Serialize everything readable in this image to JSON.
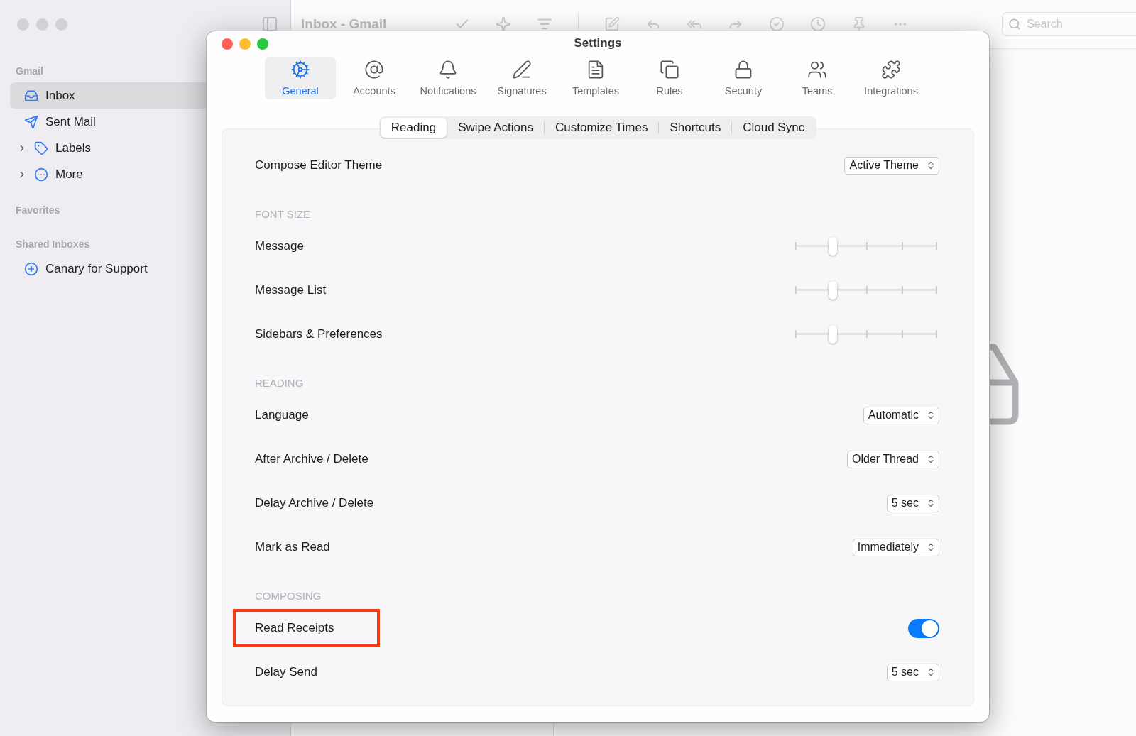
{
  "mail_window": {
    "title": "Inbox - Gmail",
    "search": {
      "placeholder": "Search"
    },
    "sidebar": [
      {
        "heading": "Gmail",
        "items": [
          {
            "label": "Inbox",
            "selected": true,
            "expandable": false
          },
          {
            "label": "Sent Mail",
            "selected": false,
            "expandable": false
          },
          {
            "label": "Labels",
            "selected": false,
            "expandable": true
          },
          {
            "label": "More",
            "selected": false,
            "expandable": true
          }
        ]
      },
      {
        "heading": "Favorites"
      },
      {
        "heading": "Shared Inboxes",
        "items": [
          {
            "label": "Canary for Support",
            "selected": false,
            "expandable": false
          }
        ]
      }
    ]
  },
  "settings": {
    "title": "Settings",
    "tabs": [
      {
        "label": "General",
        "selected": true
      },
      {
        "label": "Accounts",
        "selected": false
      },
      {
        "label": "Notifications",
        "selected": false
      },
      {
        "label": "Signatures",
        "selected": false
      },
      {
        "label": "Templates",
        "selected": false
      },
      {
        "label": "Rules",
        "selected": false
      },
      {
        "label": "Security",
        "selected": false
      },
      {
        "label": "Teams",
        "selected": false
      },
      {
        "label": "Integrations",
        "selected": false
      }
    ],
    "subtabs": [
      {
        "label": "Reading",
        "selected": true
      },
      {
        "label": "Swipe Actions",
        "selected": false
      },
      {
        "label": "Customize Times",
        "selected": false
      },
      {
        "label": "Shortcuts",
        "selected": false
      },
      {
        "label": "Cloud Sync",
        "selected": false
      }
    ],
    "rows": [
      {
        "kind": "select",
        "label": "Compose Editor Theme",
        "value": "Active Theme"
      },
      {
        "kind": "heading",
        "label": "FONT SIZE"
      },
      {
        "kind": "slider",
        "label": "Message",
        "level": 0.25
      },
      {
        "kind": "slider",
        "label": "Message List",
        "level": 0.25
      },
      {
        "kind": "slider",
        "label": "Sidebars & Preferences",
        "level": 0.25
      },
      {
        "kind": "heading",
        "label": "READING"
      },
      {
        "kind": "select",
        "label": "Language",
        "value": "Automatic"
      },
      {
        "kind": "select",
        "label": "After Archive / Delete",
        "value": "Older Thread"
      },
      {
        "kind": "select",
        "label": "Delay Archive / Delete",
        "value": "5 sec"
      },
      {
        "kind": "select",
        "label": "Mark as Read",
        "value": "Immediately"
      },
      {
        "kind": "heading",
        "label": "COMPOSING"
      },
      {
        "kind": "toggle",
        "label": "Read Receipts",
        "on": true,
        "highlighted": true
      },
      {
        "kind": "select",
        "label": "Delay Send",
        "value": "5 sec"
      }
    ]
  }
}
